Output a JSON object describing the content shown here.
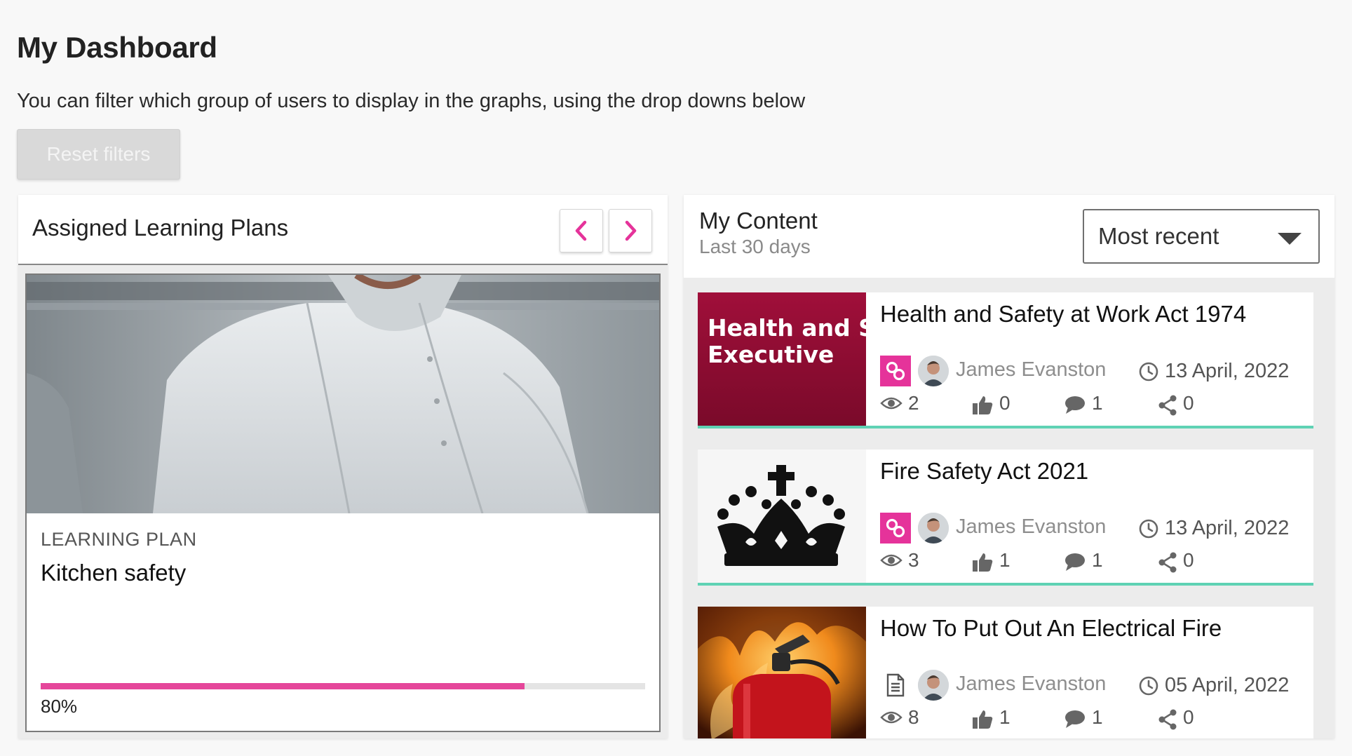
{
  "page": {
    "title": "My Dashboard",
    "description": "You can filter which group of users to display in the graphs, using the drop downs below",
    "reset_label": "Reset filters"
  },
  "learning_plans": {
    "title": "Assigned Learning Plans",
    "prev_icon": "chevron-left-icon",
    "next_icon": "chevron-right-icon",
    "accent_color": "#e5339a",
    "card": {
      "type_label": "LEARNING PLAN",
      "name": "Kitchen safety",
      "progress": 0.8,
      "progress_label": "80%"
    }
  },
  "my_content": {
    "title": "My Content",
    "subtitle": "Last 30 days",
    "sort": {
      "selected": "Most recent"
    },
    "accent_line_color": "#5fd2b4",
    "items": [
      {
        "title": "Health and Safety at Work Act 1974",
        "thumb_text": [
          "Health and S",
          "Executive"
        ],
        "type_icon": "link-icon",
        "author": "James Evanston",
        "date": "13 April, 2022",
        "views": "2",
        "likes": "0",
        "comments": "1",
        "shares": "0"
      },
      {
        "title": "Fire Safety Act 2021",
        "type_icon": "link-icon",
        "author": "James Evanston",
        "date": "13 April, 2022",
        "views": "3",
        "likes": "1",
        "comments": "1",
        "shares": "0"
      },
      {
        "title": "How To Put Out An Electrical Fire",
        "type_icon": "document-icon",
        "author": "James Evanston",
        "date": "05 April, 2022",
        "views": "8",
        "likes": "1",
        "comments": "1",
        "shares": "0"
      }
    ]
  }
}
